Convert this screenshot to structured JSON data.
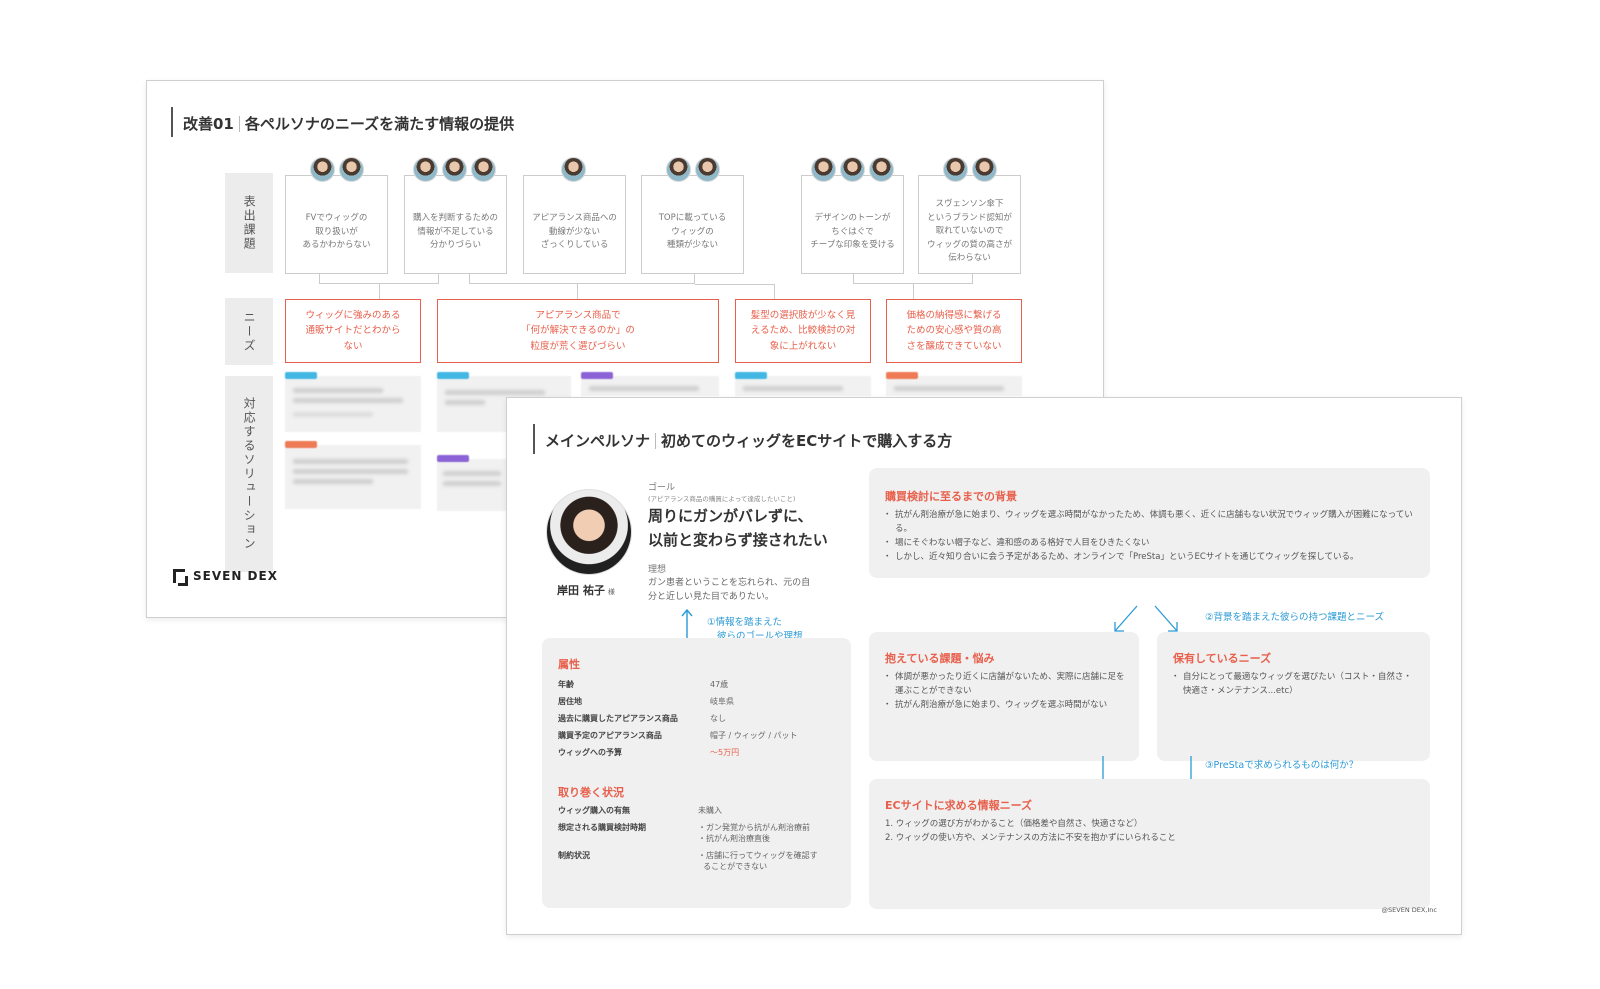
{
  "slide1": {
    "title_prefix": "改善01",
    "title": "各ペルソナのニーズを満たす情報の提供",
    "row_labels": {
      "issues": "表出課題",
      "needs": "ニーズ",
      "solutions": "対応するソリューション"
    },
    "issues": [
      {
        "text_lines": [
          "FVでウィッグの",
          "取り扱いが",
          "あるかわからない"
        ]
      },
      {
        "text_lines": [
          "購入を判断するための",
          "情報が不足している",
          "分かりづらい"
        ]
      },
      {
        "text_lines": [
          "アピアランス商品への",
          "動線が少ない",
          "ざっくりしている"
        ]
      },
      {
        "text_lines": [
          "TOPに載っている",
          "ウィッグの",
          "種類が少ない"
        ]
      },
      {
        "text_lines": [
          "デザインのトーンが",
          "ちぐはぐで",
          "チープな印象を受ける"
        ]
      },
      {
        "text_lines": [
          "スヴェンソン傘下",
          "というブランド認知が",
          "取れていないので",
          "ウィッグの質の高さが",
          "伝わらない"
        ]
      }
    ],
    "needs": [
      {
        "text_lines": [
          "ウィッグに強みのある",
          "通販サイトだとわから",
          "ない"
        ]
      },
      {
        "text_lines": [
          "アピアランス商品で",
          "「何が解決できるのか」の",
          "粒度が荒く選びづらい"
        ]
      },
      {
        "text_lines": [
          "髪型の選択肢が少なく見",
          "えるため、比較検討の対",
          "象に上がれない"
        ]
      },
      {
        "text_lines": [
          "価格の納得感に繋げる",
          "ための安心感や質の高",
          "さを醸成できていない"
        ]
      }
    ],
    "logo": "SEVEN DEX"
  },
  "slide2": {
    "title_prefix": "メインペルソナ",
    "title": "初めてのウィッグをECサイトで購入する方",
    "persona_name": "岸田 祐子",
    "persona_honorific": "様",
    "goal_label": "ゴール",
    "goal_sub": "(アピアランス商品の購買によって達成したいこと)",
    "goal_lines": [
      "周りにガンがバレずに、",
      "以前と変わらず接されたい"
    ],
    "ideal_label": "理想",
    "ideal_lines": [
      "ガン患者ということを忘れられ、元の自",
      "分と近しい見た目でありたい。"
    ],
    "annot1_lines": [
      "①情報を踏まえた",
      "彼らのゴールや理想"
    ],
    "annot2": "②背景を踏まえた彼らの持つ課題とニーズ",
    "annot3": "③PreStaで求められるものは何か？",
    "attributes": {
      "heading": "属性",
      "rows": [
        {
          "k": "年齢",
          "v": "47歳"
        },
        {
          "k": "居住地",
          "v": "岐阜県"
        },
        {
          "k": "過去に購買したアピアランス商品",
          "v": "なし"
        },
        {
          "k": "購買予定のアピアランス商品",
          "v": "帽子 / ウィッグ / パット"
        },
        {
          "k": "ウィッグへの予算",
          "v": "〜5万円"
        }
      ]
    },
    "situation": {
      "heading": "取り巻く状況",
      "rows": [
        {
          "k": "ウィッグ購入の有無",
          "v": "未購入"
        },
        {
          "k": "想定される購買検討時期",
          "v1": "・ガン発覚から抗がん剤治療前",
          "v2": "・抗がん剤治療直後"
        },
        {
          "k": "制約状況",
          "v1": "・店舗に行ってウィッグを確認す",
          "v2": "  ることができない"
        }
      ]
    },
    "background": {
      "heading": "購買検討に至るまでの背景",
      "items": [
        "抗がん剤治療が急に始まり、ウィッグを選ぶ時間がなかったため、体調も悪く、近くに店舗もない状況でウィッグ購入が困難になっている。",
        "場にそぐわない帽子など、違和感のある格好で人目をひきたくない",
        "しかし、近々知り合いに会う予定があるため、オンラインで「PreSta」というECサイトを通じてウィッグを探している。"
      ]
    },
    "problems": {
      "heading": "抱えている課題・悩み",
      "items": [
        "体調が悪かったり近くに店舗がないため、実際に店舗に足を運ぶことができない",
        "抗がん剤治療が急に始まり、ウィッグを選ぶ時間がない"
      ]
    },
    "needs": {
      "heading": "保有しているニーズ",
      "items": [
        "自分にとって最適なウィッグを選びたい（コスト・自然さ・快適さ・メンテナンス...etc）"
      ]
    },
    "ec_needs": {
      "heading": "ECサイトに求める情報ニーズ",
      "items": [
        "1. ウィッグの選び方がわかること（価格差や自然さ、快適さなど）",
        "2. ウィッグの使い方や、メンテナンスの方法に不安を抱かずにいられること"
      ]
    },
    "copyright": "@SEVEN DEX,Inc"
  }
}
